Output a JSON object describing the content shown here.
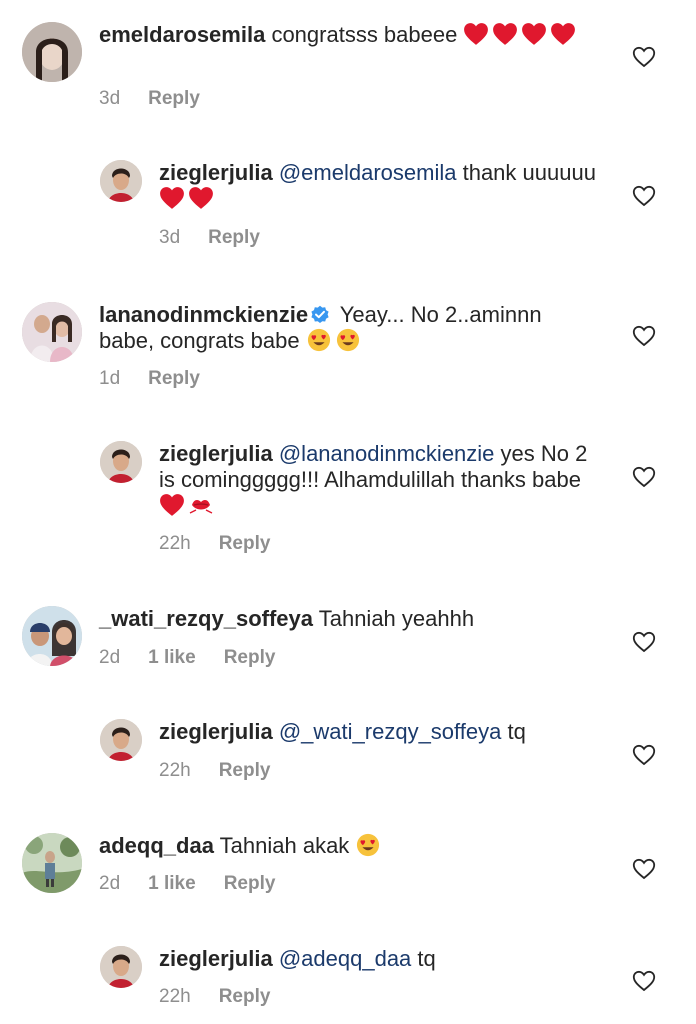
{
  "comments": [
    {
      "username": "emeldarosemila",
      "mention": "",
      "text": "congratsss babeee",
      "emoji": [
        "red-heart",
        "red-heart",
        "red-heart",
        "red-heart"
      ],
      "time": "3d",
      "likes": "",
      "reply_label": "Reply"
    },
    {
      "username": "zieglerjulia",
      "mention": "@emeldarosemila",
      "text": "thank uuuuuu",
      "emoji": [
        "red-heart",
        "red-heart"
      ],
      "time": "3d",
      "likes": "",
      "reply_label": "Reply"
    },
    {
      "username": "lananodinmckienzie",
      "verified": true,
      "mention": "",
      "text": "Yeay... No 2..aminnn babe, congrats babe",
      "emoji": [
        "heart-eyes",
        "heart-eyes"
      ],
      "time": "1d",
      "likes": "",
      "reply_label": "Reply"
    },
    {
      "username": "zieglerjulia",
      "mention": "@lananodinmckienzie",
      "text": "yes No 2 is cominggggg!!! Alhamdulillah thanks babe",
      "emoji": [
        "red-heart",
        "kiss-mark"
      ],
      "time": "22h",
      "likes": "",
      "reply_label": "Reply"
    },
    {
      "username": "_wati_rezqy_soffeya",
      "mention": "",
      "text": "Tahniah yeahhh",
      "emoji": [],
      "time": "2d",
      "likes": "1 like",
      "reply_label": "Reply"
    },
    {
      "username": "zieglerjulia",
      "mention": "@_wati_rezqy_soffeya",
      "text": "tq",
      "emoji": [],
      "time": "22h",
      "likes": "",
      "reply_label": "Reply"
    },
    {
      "username": "adeqq_daa",
      "mention": "",
      "text": "Tahniah akak",
      "emoji": [
        "heart-eyes"
      ],
      "time": "2d",
      "likes": "1 like",
      "reply_label": "Reply"
    },
    {
      "username": "zieglerjulia",
      "mention": "@adeqq_daa",
      "text": "tq",
      "emoji": [],
      "time": "22h",
      "likes": "",
      "reply_label": "Reply"
    }
  ],
  "colors": {
    "text": "#262626",
    "meta": "#8e8e8e",
    "mention": "#1b3a6b",
    "heart": "#e0182e",
    "verified": "#3897f0"
  }
}
